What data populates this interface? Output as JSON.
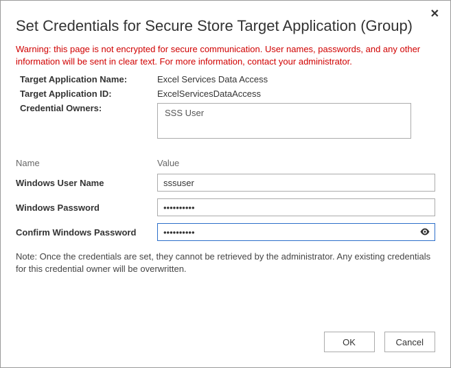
{
  "dialog": {
    "title": "Set Credentials for Secure Store Target Application (Group)",
    "warning": "Warning: this page is not encrypted for secure communication. User names, passwords, and any other information will be sent in clear text. For more information, contact your administrator.",
    "labels": {
      "targetAppName": "Target Application Name:",
      "targetAppId": "Target Application ID:",
      "credentialOwners": "Credential Owners:"
    },
    "values": {
      "targetAppName": "Excel Services Data Access",
      "targetAppId": "ExcelServicesDataAccess",
      "credentialOwners": "SSS User"
    },
    "columns": {
      "name": "Name",
      "value": "Value"
    },
    "fields": {
      "username": {
        "label": "Windows User Name",
        "value": "sssuser"
      },
      "password": {
        "label": "Windows Password",
        "value": "••••••••••"
      },
      "confirm": {
        "label": "Confirm Windows Password",
        "value": "••••••••••"
      }
    },
    "note": "Note: Once the credentials are set, they cannot be retrieved by the administrator. Any existing credentials for this credential owner will be overwritten.",
    "buttons": {
      "ok": "OK",
      "cancel": "Cancel"
    }
  }
}
